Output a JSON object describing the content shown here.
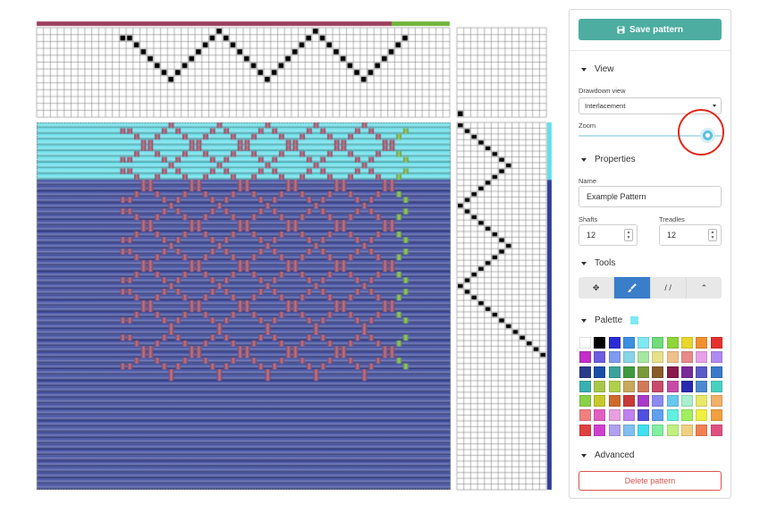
{
  "sidebar": {
    "save_label": "Save pattern",
    "view": {
      "heading": "View",
      "drawdown_label": "Drawdown view",
      "drawdown_value": "Interlacement",
      "zoom_label": "Zoom",
      "zoom_level": 0.9
    },
    "properties": {
      "heading": "Properties",
      "name_label": "Name",
      "name_value": "Example Pattern",
      "shafts_label": "Shafts",
      "shafts_value": "12",
      "treadles_label": "Treadles",
      "treadles_value": "12"
    },
    "tools": {
      "heading": "Tools",
      "items": [
        {
          "name": "move-icon",
          "glyph": "✥",
          "active": false
        },
        {
          "name": "paintbrush-icon",
          "glyph": "",
          "active": true
        },
        {
          "name": "line-icon",
          "glyph": "/ /",
          "active": false
        },
        {
          "name": "chevron-up-icon",
          "glyph": "⌃",
          "active": false
        }
      ]
    },
    "palette": {
      "heading": "Palette",
      "selected_color": "#7fe8f2",
      "colors": [
        "#ffffff",
        "#000000",
        "#2b2bd6",
        "#3a8fe0",
        "#7fe8f2",
        "#6fdb7a",
        "#8ed63a",
        "#e6d62e",
        "#f0902f",
        "#e6302e",
        "#c32ec9",
        "#6f5de0",
        "#7f9bf0",
        "#8ad4e8",
        "#a6e8a0",
        "#e8e08a",
        "#f0c08a",
        "#e88a8a",
        "#e8a0e8",
        "#b08af0",
        "#2a3a8a",
        "#1a4fa8",
        "#3aa39a",
        "#3f9a3f",
        "#7a9a3a",
        "#8a5a2a",
        "#8a1a4a",
        "#7a2a9a",
        "#5a5ac8",
        "#3a7ac8",
        "#3ab0b0",
        "#a8c84a",
        "#b0d04a",
        "#c8a85a",
        "#d07a5a",
        "#c84a6a",
        "#c84aa8",
        "#2a2ab0",
        "#4a8ad0",
        "#4ad0c0",
        "#8ad04a",
        "#c8c82a",
        "#d06a2a",
        "#c83a3a",
        "#a83ac8",
        "#8a8af0",
        "#6ac8f0",
        "#a8f0d0",
        "#e8e86a",
        "#f0b06a",
        "#f08080",
        "#e060c0",
        "#e8a0e0",
        "#c080f0",
        "#5050e0",
        "#60a0f0",
        "#60f0e0",
        "#a0f060",
        "#f0f040",
        "#f0a040",
        "#e04040",
        "#d040d0",
        "#b0a0f0",
        "#80c0f0",
        "#40e0f0",
        "#80f0a0",
        "#c0f080",
        "#f0d080",
        "#f08050",
        "#e05080",
        "#c050c0",
        "#4040c0"
      ]
    },
    "advanced": {
      "heading": "Advanced",
      "delete_label": "Delete pattern"
    }
  },
  "draft": {
    "colors": {
      "pink_thread": "#9c3f5e",
      "green_thread": "#6fb33a",
      "cyan_weft": "#5fe0ec",
      "blue_weft": "#2f3d98",
      "black_cell": "#000000"
    },
    "top_bar_split_fraction": 0.86,
    "cyan_weft_rows": 10,
    "total_weft_rows": 64,
    "threading_points": [
      [
        12,
        7
      ],
      [
        13,
        7
      ],
      [
        14,
        8
      ],
      [
        15,
        9
      ],
      [
        16,
        10
      ],
      [
        17,
        11
      ],
      [
        18,
        12
      ],
      [
        19,
        13
      ],
      [
        20,
        12
      ],
      [
        21,
        11
      ],
      [
        22,
        10
      ],
      [
        23,
        9
      ],
      [
        24,
        8
      ],
      [
        25,
        7
      ],
      [
        26,
        6
      ],
      [
        27,
        7
      ],
      [
        28,
        8
      ],
      [
        29,
        9
      ],
      [
        30,
        10
      ],
      [
        31,
        11
      ],
      [
        32,
        12
      ],
      [
        33,
        13
      ],
      [
        34,
        12
      ],
      [
        35,
        11
      ],
      [
        36,
        10
      ],
      [
        37,
        9
      ],
      [
        38,
        8
      ],
      [
        39,
        7
      ],
      [
        40,
        6
      ],
      [
        41,
        7
      ],
      [
        42,
        8
      ],
      [
        43,
        9
      ],
      [
        44,
        10
      ],
      [
        45,
        11
      ],
      [
        46,
        12
      ],
      [
        47,
        13
      ],
      [
        48,
        12
      ],
      [
        49,
        11
      ],
      [
        50,
        10
      ],
      [
        51,
        9
      ],
      [
        52,
        8
      ],
      [
        53,
        7
      ]
    ],
    "treadling_points": [
      [
        0,
        0
      ],
      [
        1,
        1
      ],
      [
        2,
        2
      ],
      [
        3,
        3
      ],
      [
        4,
        4
      ],
      [
        5,
        5
      ],
      [
        6,
        6
      ],
      [
        7,
        7
      ],
      [
        6,
        8
      ],
      [
        5,
        9
      ],
      [
        4,
        10
      ],
      [
        3,
        11
      ],
      [
        2,
        12
      ],
      [
        1,
        13
      ],
      [
        0,
        14
      ],
      [
        1,
        15
      ],
      [
        2,
        16
      ],
      [
        3,
        17
      ],
      [
        4,
        18
      ],
      [
        5,
        19
      ],
      [
        6,
        20
      ],
      [
        7,
        21
      ],
      [
        6,
        22
      ],
      [
        5,
        23
      ],
      [
        4,
        24
      ],
      [
        3,
        25
      ],
      [
        2,
        26
      ],
      [
        1,
        27
      ],
      [
        0,
        28
      ],
      [
        1,
        29
      ],
      [
        2,
        30
      ],
      [
        3,
        31
      ],
      [
        4,
        32
      ],
      [
        5,
        33
      ],
      [
        6,
        34
      ],
      [
        7,
        35
      ],
      [
        8,
        36
      ],
      [
        9,
        37
      ],
      [
        10,
        38
      ],
      [
        11,
        39
      ],
      [
        12,
        40
      ],
      [
        13,
        41
      ],
      [
        14,
        42
      ],
      [
        15,
        43
      ],
      [
        16,
        44
      ]
    ],
    "tieup_points": [
      [
        0,
        0
      ]
    ]
  }
}
